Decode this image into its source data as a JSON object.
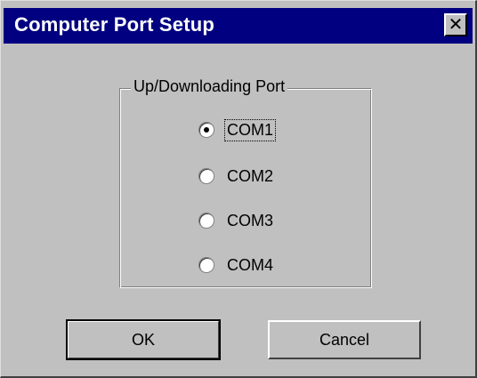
{
  "window": {
    "title": "Computer  Port Setup",
    "close_symbol": "✕",
    "colors": {
      "titlebar": "#000080",
      "face": "#c0c0c0",
      "title_text": "#ffffff"
    }
  },
  "group": {
    "label": "Up/Downloading Port",
    "options": [
      {
        "label": "COM1",
        "checked": true,
        "focused": true
      },
      {
        "label": "COM2",
        "checked": false
      },
      {
        "label": "COM3",
        "checked": false
      },
      {
        "label": "COM4",
        "checked": false
      }
    ]
  },
  "buttons": {
    "ok_label": "OK",
    "cancel_label": "Cancel"
  },
  "icons": {
    "close": "close-icon"
  }
}
